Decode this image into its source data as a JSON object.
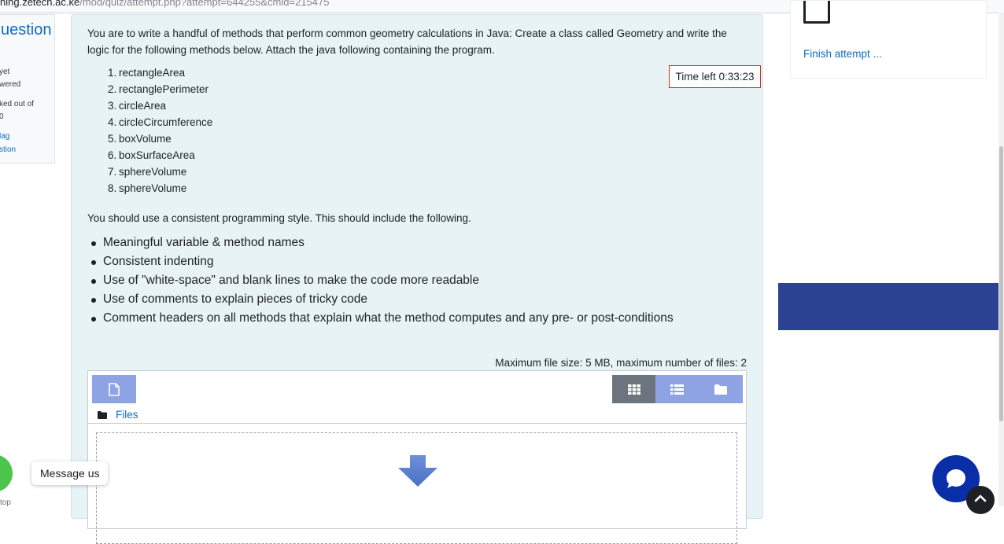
{
  "browser": {
    "url_host": "hing.zetech.ac.ke",
    "url_path": "/mod/quiz/attempt.php?attempt=644255&cmid=215475"
  },
  "question_info": {
    "number_label": "uestion",
    "status_line1": "yet",
    "status_line2": "wered",
    "marks_line1": "ked out of",
    "marks_line2": "0",
    "flag_line1": "lag",
    "flag_line2": "stion"
  },
  "question": {
    "intro": "You are to write a handful of methods that perform common geometry calculations in Java: Create a class called Geometry and write the logic for the following methods below. Attach the java following containing the program.",
    "timer": "Time left 0:33:23",
    "methods": [
      {
        "num": "1.",
        "name": "rectangleArea"
      },
      {
        "num": "2.",
        "name": "rectanglePerimeter"
      },
      {
        "num": "3.",
        "name": "circleArea"
      },
      {
        "num": "4.",
        "name": "circleCircumference"
      },
      {
        "num": "5.",
        "name": "boxVolume"
      },
      {
        "num": "6.",
        "name": "boxSurfaceArea"
      },
      {
        "num": "7.",
        "name": "sphereVolume"
      },
      {
        "num": "8.",
        "name": "sphereVolume"
      }
    ],
    "style_intro": "You should use a consistent programming style. This should include the following.",
    "style_points": [
      "Meaningful variable & method names",
      "Consistent indenting",
      "Use of \"white-space\" and blank lines to make the code more readable",
      "Use of comments to explain pieces of tricky code",
      "Comment headers on all methods that explain what the method computes and any pre- or post-conditions"
    ]
  },
  "file_manager": {
    "max_size": "Maximum file size: 5 MB, maximum number of files: 2",
    "path_label": "Files",
    "active_view": "icons"
  },
  "sidebar": {
    "finish_label": "Finish attempt ..."
  },
  "widgets": {
    "message_us": "Message us",
    "bottom_left": "top"
  },
  "colors": {
    "link": "#0f6cbf",
    "question_bg": "#e7f3f5",
    "button_blue": "#8da3e3",
    "banner_blue": "#2b4192",
    "chat_blue": "#0a2ea8",
    "whatsapp_green": "#4cc54c",
    "timer_border": "#ca3120"
  }
}
